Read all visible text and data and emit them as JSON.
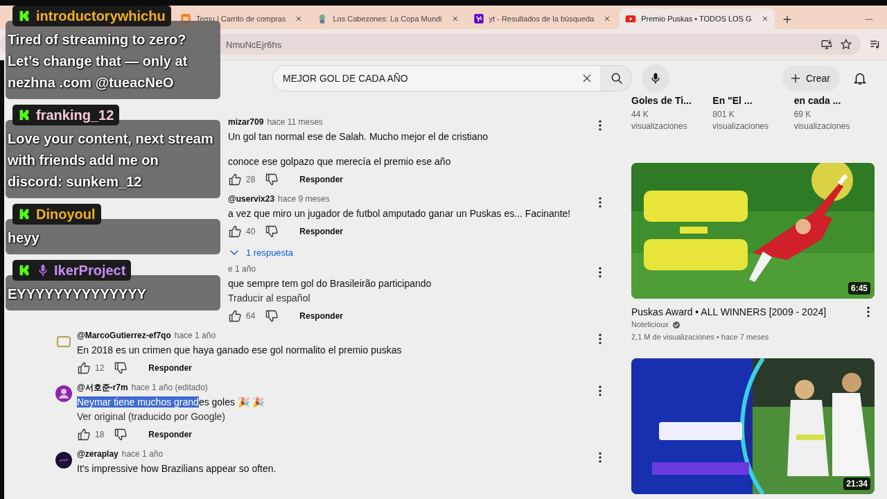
{
  "browser": {
    "tabs": [
      {
        "title": "Temu | Carrito de compras",
        "kind": "temu",
        "selected": false
      },
      {
        "title": "Los Cabezones: La Copa Mundi",
        "kind": "game",
        "selected": false
      },
      {
        "title": "yt - Resultados de la búsqueda",
        "kind": "yahoo",
        "selected": false
      },
      {
        "title": "Premio Puskas • TODOS LOS G",
        "kind": "youtube",
        "selected": true
      }
    ],
    "address": "NmuNcEjr6hs"
  },
  "header": {
    "search": "MEJOR GOL DE CADA AÑO",
    "create": "Crear"
  },
  "comments": [
    {
      "kind": "covered",
      "author": "mizar709",
      "time": "hace 11 meses",
      "lines": [
        "Un gol tan normal ese de Salah. Mucho mejor el de cristiano",
        "conoce ese golpazo que merecía el premio ese año"
      ],
      "likes": "28",
      "reply": "Responder"
    },
    {
      "kind": "covered",
      "author": "@uservix23",
      "time": "hace 9 meses",
      "lines": [
        "a vez que miro un jugador de futbol amputado ganar un Puskas es... Facinante!"
      ],
      "likes": "40",
      "reply": "Responder",
      "replies": "1 respuesta"
    },
    {
      "kind": "covered",
      "time": "e 1 año",
      "lines": [
        "que sempre tem gol do Brasileirão participando"
      ],
      "translate": "Traducir al español",
      "likes": "64",
      "reply": "Responder"
    },
    {
      "kind": "frame",
      "author": "@MarcoGutierrez-ef7qo",
      "time": "hace 1 año",
      "lines": [
        "En 2018 es un crimen que haya ganado ese gol normalito el premio puskas"
      ],
      "likes": "12",
      "reply": "Responder"
    },
    {
      "kind": "person",
      "author": "@서호준-r7m",
      "time": "hace 1 año (editado)",
      "selected_text": "Neymar tiene muchos grand",
      "lines": [
        "es goles 🎉 🎉"
      ],
      "translate": "Ver original (traducido por Google)",
      "likes": "18",
      "reply": "Responder"
    },
    {
      "kind": "dark",
      "author": "@zeraplay",
      "time": "hace 1 año",
      "lines": [
        "It's impressive how Brazilians appear so often."
      ]
    }
  ],
  "side": {
    "mini_cards": [
      {
        "title": "Goles de Ti...",
        "views": "44 K",
        "views_label": "visualizaciones"
      },
      {
        "title": "En \"El ...",
        "views": "801 K",
        "views_label": "visualizaciones"
      },
      {
        "title": "en cada ...",
        "views": "69 K",
        "views_label": "visualizaciones"
      }
    ],
    "videos": [
      {
        "duration": "6:45",
        "title": "Puskas Award • ALL WINNERS [2009 - 2024]",
        "channel": "Notelicioux",
        "verified": true,
        "stats": "2,1 M de visualizaciones • hace 7 meses"
      },
      {
        "duration": "21:34"
      }
    ]
  },
  "chat": [
    {
      "name": "introductorywhichu",
      "color": "#f2b01e",
      "mic": false,
      "message": "Tired of streaming to zero? Let’s change that — only at nezhna .com @tueacNeO"
    },
    {
      "name": "franking_12",
      "color": "#f6c9dc",
      "mic": false,
      "message": "Love your content, next stream with friends add me on discord: sunkem_12"
    },
    {
      "name": "Dinoyoul",
      "color": "#f2b01e",
      "mic": false,
      "message": "heyy"
    },
    {
      "name": "IkerProject",
      "color": "#c78ff2",
      "mic": true,
      "message": "EYYYYYYYYYYYYYY"
    }
  ]
}
